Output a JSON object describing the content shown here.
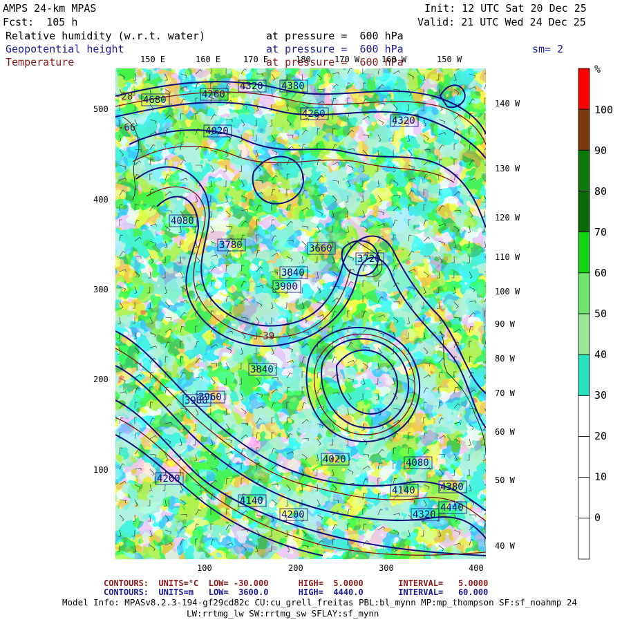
{
  "header": {
    "model": "AMPS 24-km MPAS",
    "forecast": "Fcst:  105 h",
    "init": "Init: 12 UTC Sat 20 Dec 25",
    "valid": "Valid: 21 UTC Wed 24 Dec 25"
  },
  "fields": [
    {
      "name": "Relative humidity (w.r.t. water)",
      "level": "at pressure =  600 hPa",
      "color": "#000000"
    },
    {
      "name": "Geopotential height",
      "level": "at pressure =  600 hPa",
      "color": "#1a1a9a"
    },
    {
      "name": "Temperature",
      "level": "at pressure =  600 hPa",
      "color": "#8b1a1a"
    }
  ],
  "smoothing": "sm= 2",
  "top_longitudes": [
    "150 E",
    "160 E",
    "170 E",
    "180",
    "170 W",
    "160 W",
    "150 W"
  ],
  "right_longitudes": [
    "140 W",
    "130 W",
    "120 W",
    "110 W",
    "100 W",
    "90 W",
    "80 W",
    "70 W",
    "60 W",
    "50 W",
    "40 W"
  ],
  "y_ticks": [
    "500",
    "400",
    "300",
    "200",
    "100"
  ],
  "x_ticks": [
    "100",
    "200",
    "300",
    "400"
  ],
  "colorbar": {
    "unit": "%",
    "labels": [
      "100",
      "90",
      "80",
      "70",
      "60",
      "50",
      "40",
      "30",
      "20",
      "10",
      "0"
    ],
    "colors": [
      "#ff0000",
      "#7a3a0a",
      "#0a7a0a",
      "#0a6a0a",
      "#14d214",
      "#6ee66e",
      "#9ae89a",
      "#28e2be",
      "#ffffff",
      "#ffffff",
      "#ffffff",
      "#ffffff"
    ]
  },
  "height_labels": [
    "4680",
    "4260",
    "4320",
    "4380",
    "4260",
    "4320",
    "4020",
    "4080",
    "3840",
    "3900",
    "3660",
    "3720",
    "3780",
    "3960",
    "4140",
    "4200",
    "4080",
    "4140",
    "4020",
    "4440",
    "4380",
    "3840",
    "3900",
    "4260",
    "4320"
  ],
  "temp_labels": [
    "-66",
    "-28",
    "-39"
  ],
  "footer": {
    "temp_line": "CONTOURS:  UNITS=°C  LOW= -30.000      HIGH=  5.0000       INTERVAL=   5.0000",
    "height_line": "CONTOURS:  UNITS=m   LOW=  3600.0      HIGH=  4440.0       INTERVAL=   60.000",
    "model_info": "Model Info: MPASv8.2.3-194-gf29cd82c CU:cu_grell_freitas PBL:bl_mynn MP:mp_thompson SF:sf_noahmp 24",
    "model_info2": "LW:rrtmg_lw SW:rrtmg_sw SFLAY:sf_mynn"
  }
}
